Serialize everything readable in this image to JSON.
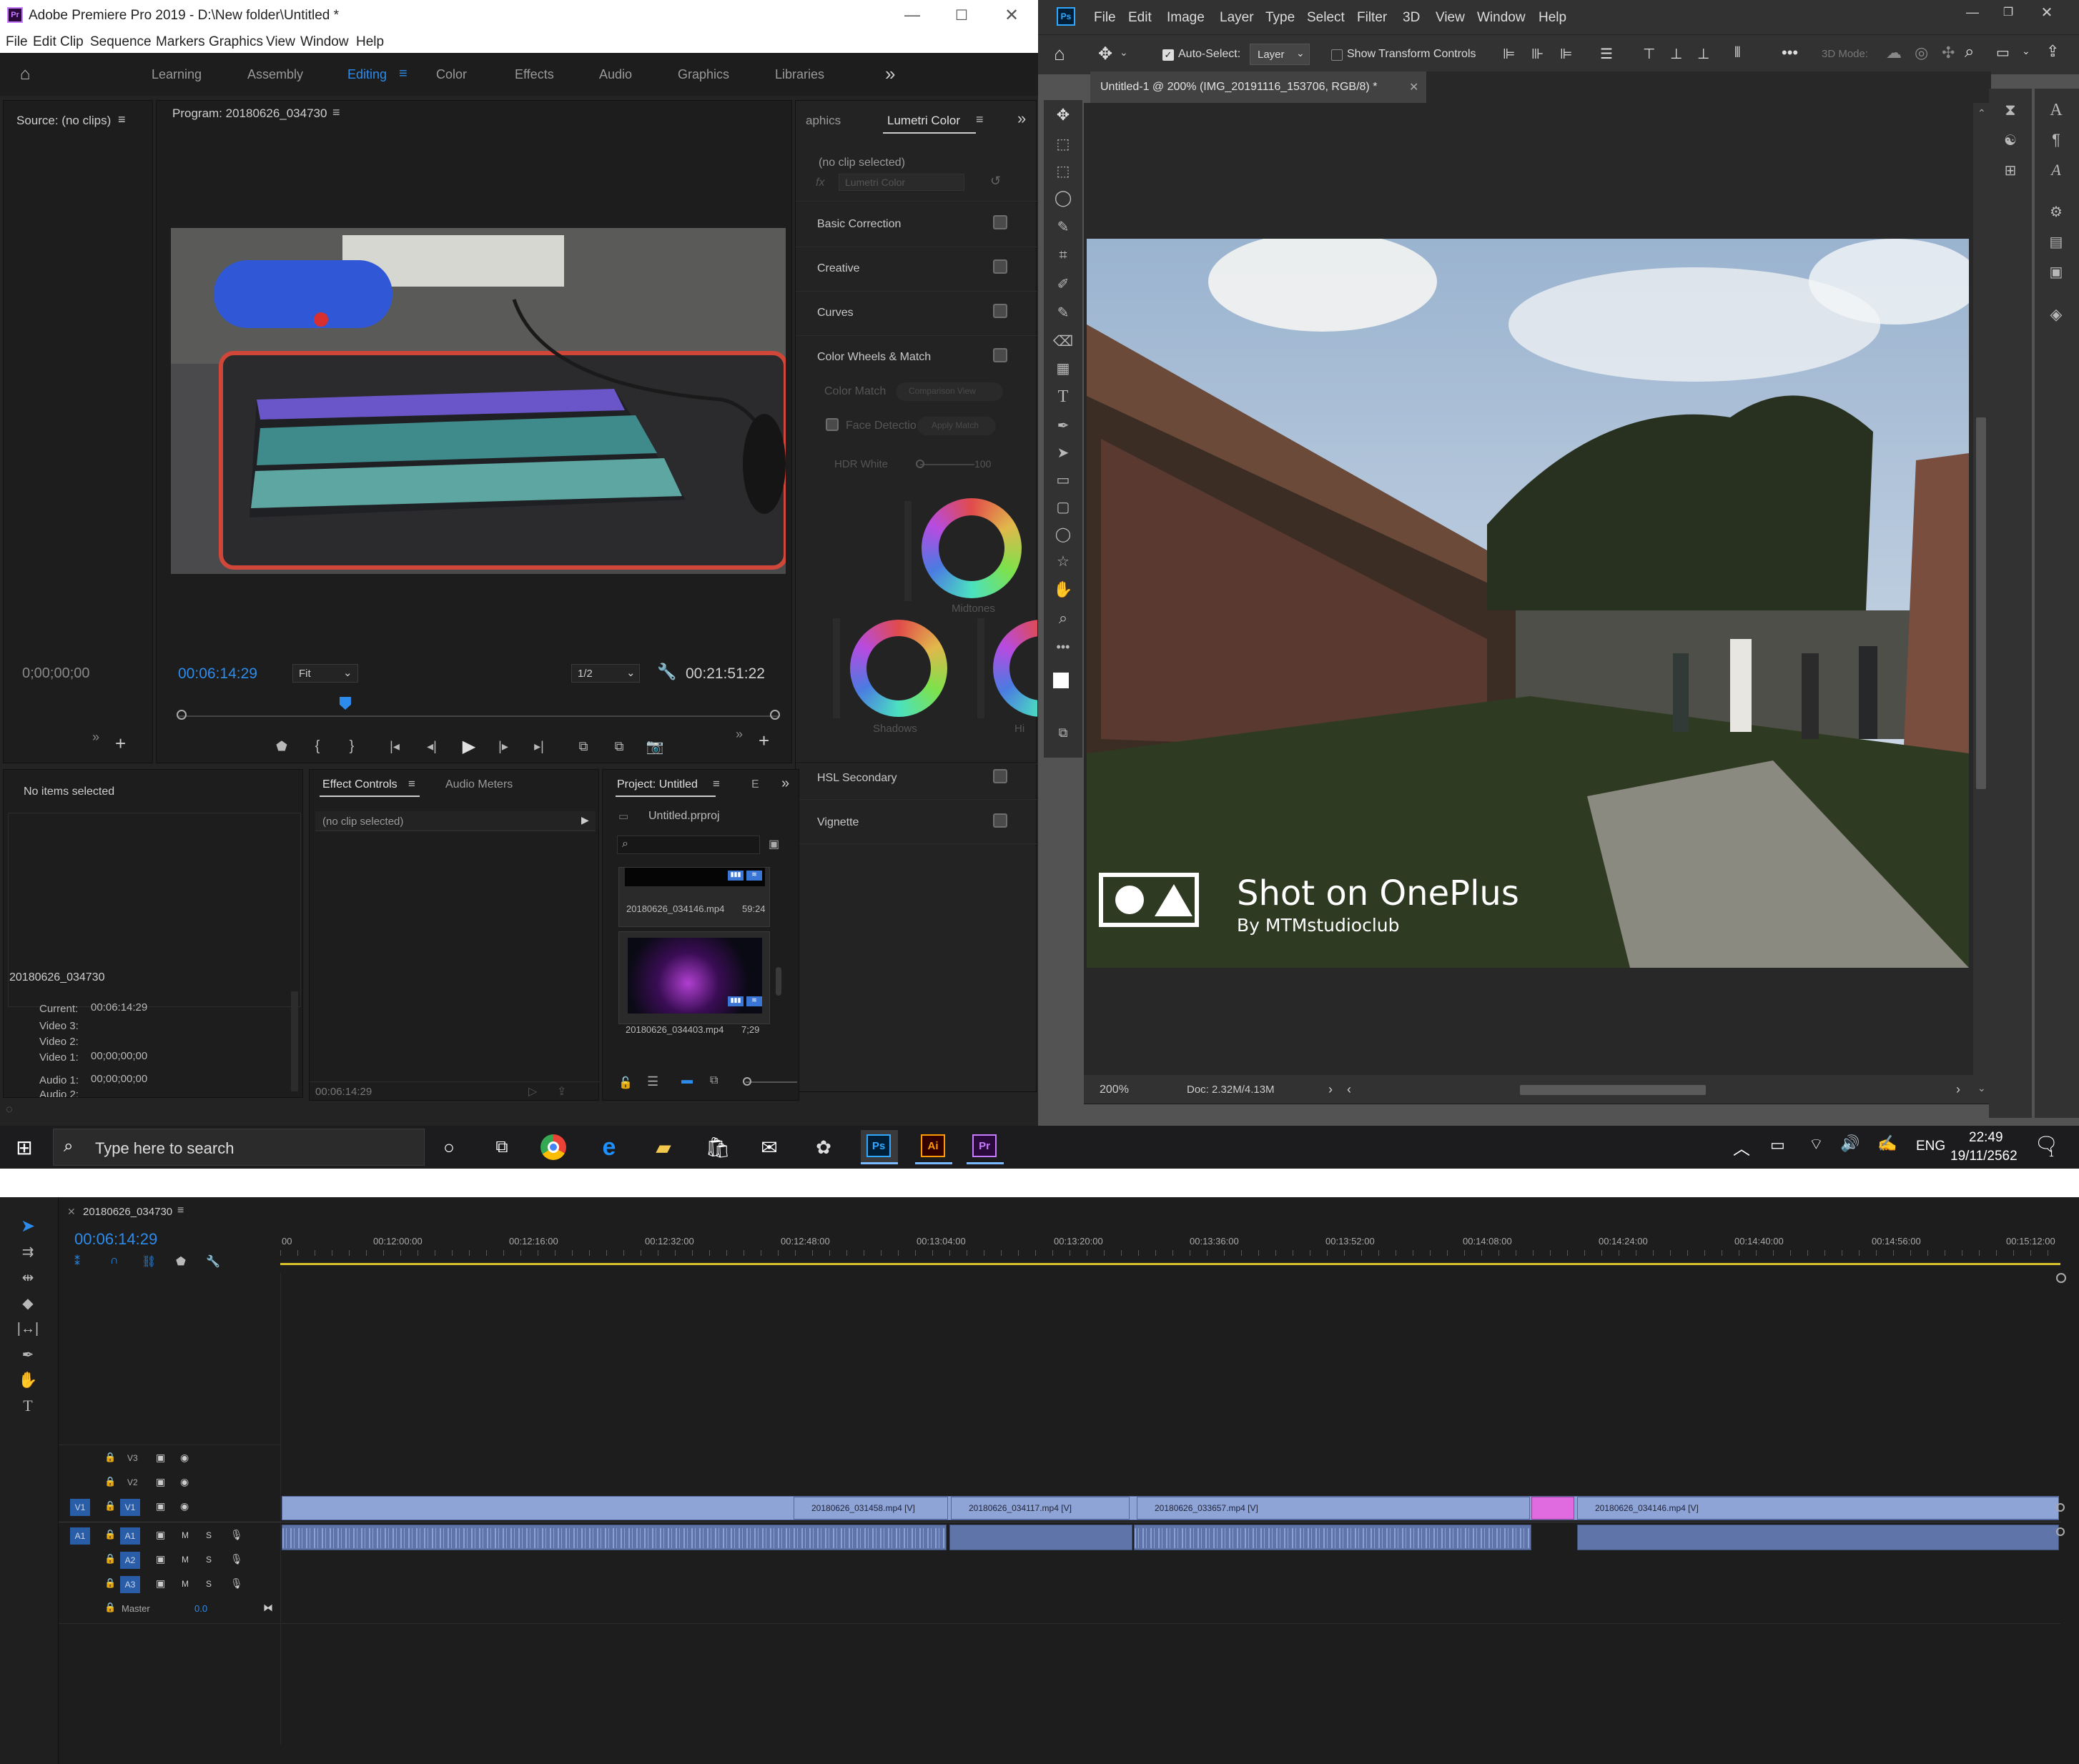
{
  "premiere": {
    "title": "Adobe Premiere Pro 2019 - D:\\New folder\\Untitled *",
    "menu": [
      "File",
      "Edit",
      "Clip",
      "Sequence",
      "Markers",
      "Graphics",
      "View",
      "Window",
      "Help"
    ],
    "workspaces": [
      "Learning",
      "Assembly",
      "Editing",
      "Color",
      "Effects",
      "Audio",
      "Graphics",
      "Libraries"
    ],
    "source_title": "Source: (no clips)",
    "source_timecode": "0;00;00;00",
    "program_title": "Program: 20180626_034730",
    "program_timecode": "00:06:14:29",
    "fit_value": "Fit",
    "resolution_value": "1/2",
    "program_duration": "00:21:51:22",
    "lumetri": {
      "tab_graphics": "aphics",
      "tab_lumetri": "Lumetri Color",
      "no_clip": "(no clip selected)",
      "fx_value": "Lumetri Color",
      "sections": [
        "Basic Correction",
        "Creative",
        "Curves",
        "Color Wheels & Match"
      ],
      "color_match": "Color Match",
      "comparison_view": "Comparison View",
      "face_detection": "Face Detectio",
      "apply_match": "Apply Match",
      "hdr_white": "HDR White",
      "hdr_value": "100",
      "midtones": "Midtones",
      "shadows": "Shadows",
      "highlights_cut": "Hi",
      "hsl_secondary": "HSL Secondary",
      "vignette": "Vignette"
    },
    "info_panel": {
      "no_items": "No items selected",
      "clip_name": "20180626_034730",
      "current_label": "Current:",
      "current_value": "00:06:14:29",
      "video3": "Video 3:",
      "video2": "Video 2:",
      "video1": "Video 1:",
      "video1_value": "00;00;00;00",
      "audio1": "Audio 1:",
      "audio1_value": "00;00;00;00",
      "audio2": "Audio 2:"
    },
    "effect_controls": {
      "tab": "Effect Controls",
      "audio_meters": "Audio Meters",
      "no_clip": "(no clip selected)",
      "footer_timecode": "00:06:14:29"
    },
    "project": {
      "tab": "Project: Untitled",
      "tab2": "E",
      "file": "Untitled.prproj",
      "items": [
        {
          "name": "20180626_034146.mp4",
          "duration": "59:24"
        },
        {
          "name": "20180626_034403.mp4",
          "duration": "7;29"
        }
      ]
    }
  },
  "photoshop": {
    "menu": [
      "File",
      "Edit",
      "Image",
      "Layer",
      "Type",
      "Select",
      "Filter",
      "3D",
      "View",
      "Window",
      "Help"
    ],
    "auto_select_label": "Auto-Select:",
    "auto_select_value": "Layer",
    "show_transform": "Show Transform Controls",
    "mode_3d": "3D Mode:",
    "doc_tab": "Untitled-1 @ 200% (IMG_20191116_153706, RGB/8) *",
    "zoom": "200%",
    "doc_size": "Doc: 2.32M/4.13M",
    "watermark_title": "Shot on OnePlus",
    "watermark_sub": "By MTMstudioclub"
  },
  "taskbar": {
    "search_placeholder": "Type here to search",
    "lang": "ENG",
    "time": "22:49",
    "date": "19/11/2562",
    "notif_count": "1"
  },
  "timeline": {
    "sequence_name": "20180626_034730",
    "timecode": "00:06:14:29",
    "ruler_labels": [
      "00",
      "00:12:00:00",
      "00:12:16:00",
      "00:12:32:00",
      "00:12:48:00",
      "00:13:04:00",
      "00:13:20:00",
      "00:13:36:00",
      "00:13:52:00",
      "00:14:08:00",
      "00:14:24:00",
      "00:14:40:00",
      "00:14:56:00",
      "00:15:12:00"
    ],
    "tracks_video": [
      "V3",
      "V2",
      "V1"
    ],
    "tracks_audio": [
      "A1",
      "A2",
      "A3"
    ],
    "source_patch_v": "V1",
    "source_patch_a": "A1",
    "master_label": "Master",
    "master_value": "0.0",
    "clips": [
      "20180626_031458.mp4 [V]",
      "20180626_034117.mp4 [V]",
      "20180626_033657.mp4 [V]",
      "20180626_034146.mp4 [V]"
    ]
  }
}
